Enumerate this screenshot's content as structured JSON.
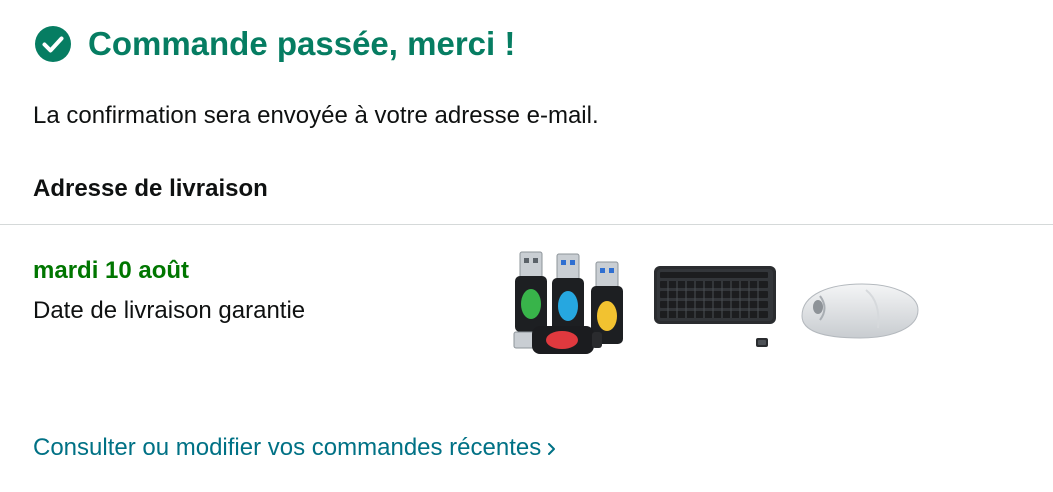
{
  "header": {
    "title": "Commande passée, merci !",
    "icon": "check-circle-icon",
    "accent_color": "#067d62"
  },
  "confirmation": {
    "text": "La confirmation sera envoyée à votre adresse e-mail."
  },
  "shipping": {
    "heading": "Adresse de livraison"
  },
  "delivery": {
    "date": "mardi 10 août",
    "date_color": "#007600",
    "note": "Date de livraison garantie"
  },
  "products": [
    {
      "icon": "usb-adapters-image"
    },
    {
      "icon": "keyboard-image"
    },
    {
      "icon": "mouse-image"
    }
  ],
  "orders_link": {
    "label": "Consulter ou modifier vos commandes récentes",
    "color": "#007185",
    "icon": "chevron-right-icon"
  }
}
